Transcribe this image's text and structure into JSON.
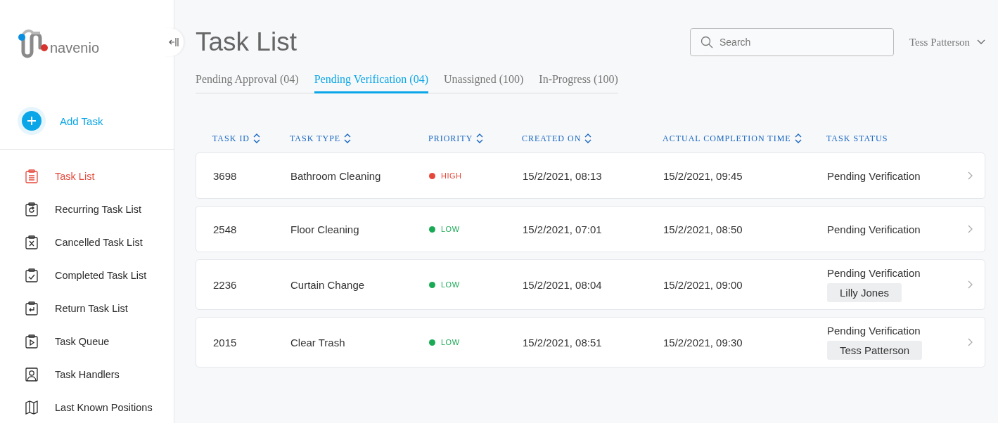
{
  "brand": {
    "name": "navenio"
  },
  "add_task": {
    "label": "Add Task"
  },
  "sidebar": {
    "items": [
      {
        "label": "Task List",
        "selected": true
      },
      {
        "label": "Recurring Task List",
        "selected": false
      },
      {
        "label": "Cancelled Task List",
        "selected": false
      },
      {
        "label": "Completed Task List",
        "selected": false
      },
      {
        "label": "Return Task List",
        "selected": false
      },
      {
        "label": "Task Queue",
        "selected": false
      },
      {
        "label": "Task Handlers",
        "selected": false
      },
      {
        "label": "Last Known Positions",
        "selected": false
      }
    ]
  },
  "page": {
    "title": "Task List"
  },
  "search": {
    "placeholder": "Search"
  },
  "user": {
    "name": "Tess Patterson"
  },
  "tabs": [
    {
      "label": "Pending Approval (04)",
      "selected": false
    },
    {
      "label": "Pending Verification (04)",
      "selected": true
    },
    {
      "label": "Unassigned (100)",
      "selected": false
    },
    {
      "label": "In-Progress (100)",
      "selected": false
    }
  ],
  "table": {
    "columns": [
      {
        "label": "TASK ID",
        "sortable": true
      },
      {
        "label": "TASK TYPE",
        "sortable": true
      },
      {
        "label": "PRIORITY",
        "sortable": true
      },
      {
        "label": "CREATED ON",
        "sortable": true
      },
      {
        "label": "ACTUAL COMPLETION TIME",
        "sortable": true
      },
      {
        "label": "TASK STATUS",
        "sortable": false
      }
    ],
    "rows": [
      {
        "id": "3698",
        "type": "Bathroom Cleaning",
        "priority": "HIGH",
        "color": "#e5483b",
        "created": "15/2/2021, 08:13",
        "completed": "15/2/2021, 09:45",
        "status": "Pending Verification"
      },
      {
        "id": "2548",
        "type": "Floor Cleaning",
        "priority": "LOW",
        "color": "#1aaa55",
        "created": "15/2/2021, 07:01",
        "completed": "15/2/2021, 08:50",
        "status": "Pending Verification"
      },
      {
        "id": "2236",
        "type": "Curtain Change",
        "priority": "LOW",
        "color": "#1aaa55",
        "created": "15/2/2021, 08:04",
        "completed": "15/2/2021, 09:00",
        "status": "Pending Verification",
        "assignee": "Lilly Jones"
      },
      {
        "id": "2015",
        "type": "Clear Trash",
        "priority": "LOW",
        "color": "#1aaa55",
        "created": "15/2/2021, 08:51",
        "completed": "15/2/2021, 09:30",
        "status": "Pending Verification",
        "assignee": "Tess Patterson"
      }
    ]
  }
}
